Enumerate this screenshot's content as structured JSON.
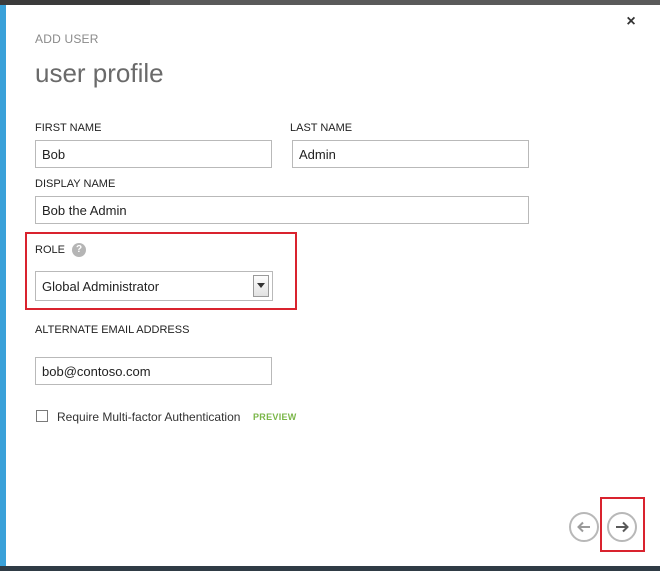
{
  "dialog": {
    "step_label": "ADD USER",
    "title": "user profile"
  },
  "form": {
    "first_name": {
      "label": "FIRST NAME",
      "value": "Bob"
    },
    "last_name": {
      "label": "LAST NAME",
      "value": "Admin"
    },
    "display_name": {
      "label": "DISPLAY NAME",
      "value": "Bob the Admin"
    },
    "role": {
      "label": "ROLE",
      "help_icon": "?",
      "selected": "Global Administrator"
    },
    "alternate_email": {
      "label": "ALTERNATE EMAIL ADDRESS",
      "value": "bob@contoso.com"
    },
    "mfa": {
      "label": "Require Multi-factor Authentication",
      "badge": "PREVIEW",
      "checked": false
    }
  },
  "buttons": {
    "close": "×"
  },
  "colors": {
    "accent_blue": "#3aa1d9",
    "highlight_red": "#d9232e",
    "preview_green": "#7ab648"
  }
}
